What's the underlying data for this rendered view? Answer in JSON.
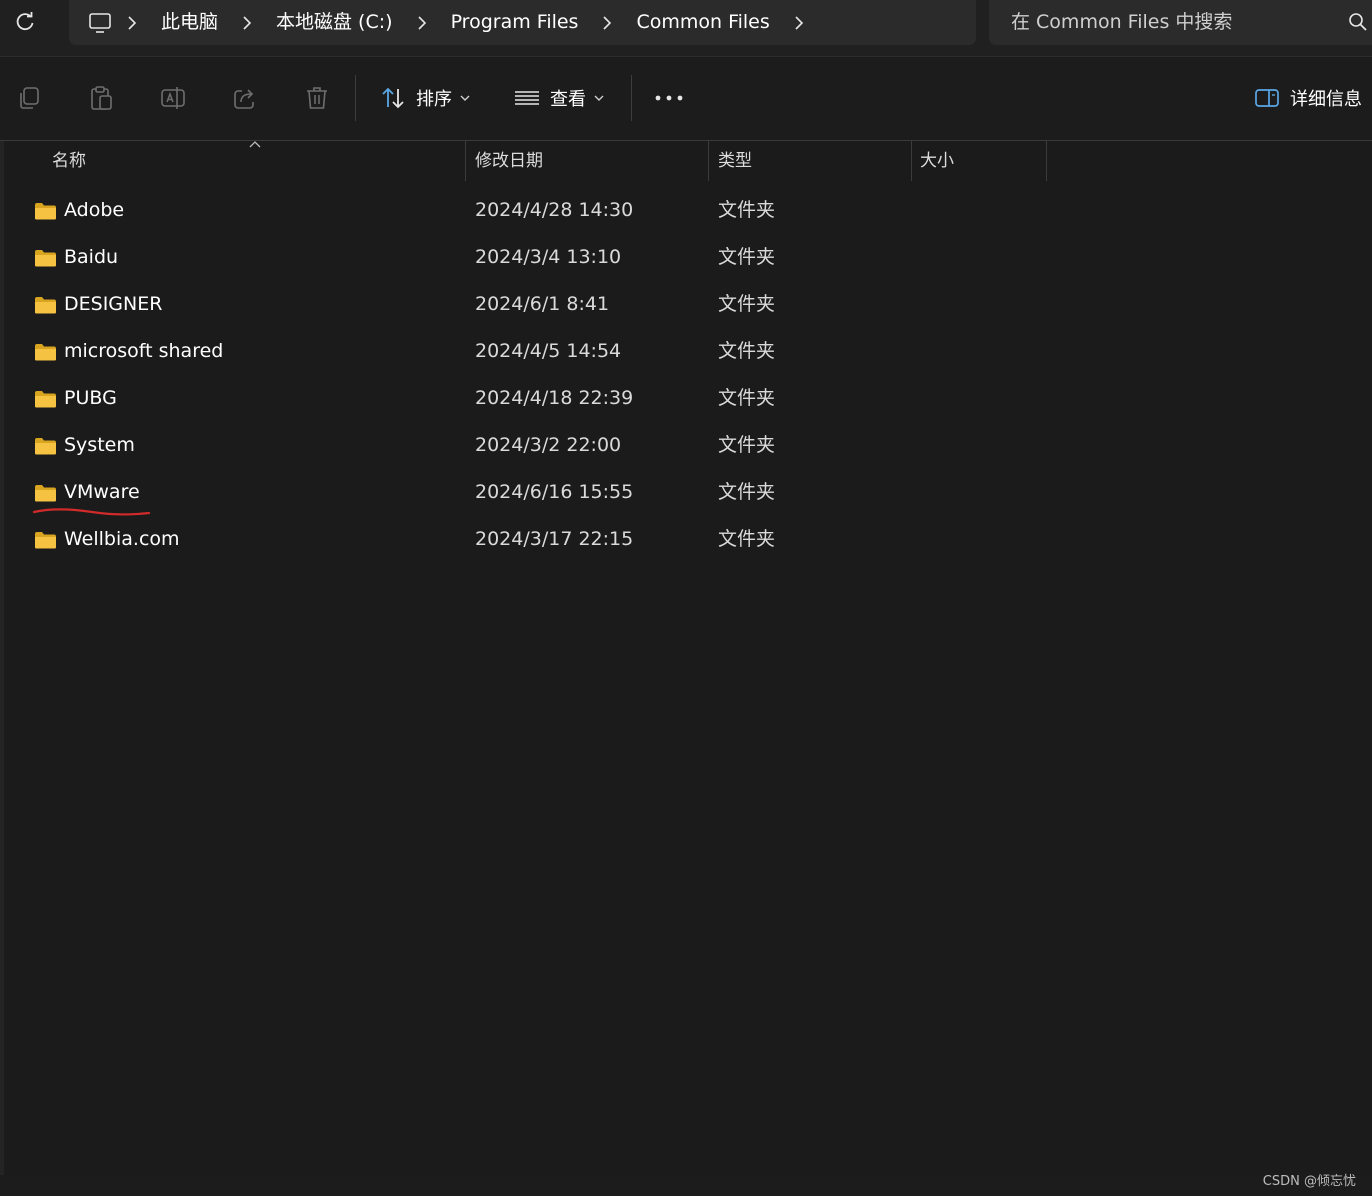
{
  "breadcrumbs": [
    "此电脑",
    "本地磁盘 (C:)",
    "Program Files",
    "Common Files"
  ],
  "search": {
    "placeholder": "在 Common Files 中搜索"
  },
  "toolbar": {
    "sort_label": "排序",
    "view_label": "查看",
    "details_label": "详细信息"
  },
  "columns": {
    "name": "名称",
    "date": "修改日期",
    "type": "类型",
    "size": "大小"
  },
  "rows": [
    {
      "name": "Adobe",
      "date": "2024/4/28 14:30",
      "type": "文件夹",
      "size": ""
    },
    {
      "name": "Baidu",
      "date": "2024/3/4 13:10",
      "type": "文件夹",
      "size": ""
    },
    {
      "name": "DESIGNER",
      "date": "2024/6/1 8:41",
      "type": "文件夹",
      "size": ""
    },
    {
      "name": "microsoft shared",
      "date": "2024/4/5 14:54",
      "type": "文件夹",
      "size": ""
    },
    {
      "name": "PUBG",
      "date": "2024/4/18 22:39",
      "type": "文件夹",
      "size": ""
    },
    {
      "name": "System",
      "date": "2024/3/2 22:00",
      "type": "文件夹",
      "size": ""
    },
    {
      "name": "VMware",
      "date": "2024/6/16 15:55",
      "type": "文件夹",
      "size": ""
    },
    {
      "name": "Wellbia.com",
      "date": "2024/3/17 22:15",
      "type": "文件夹",
      "size": ""
    }
  ],
  "colors": {
    "folder": "#f5c242",
    "annotation": "#d12a2a",
    "accent": "#5aa7e6"
  },
  "watermark": "CSDN @倾忘忧"
}
